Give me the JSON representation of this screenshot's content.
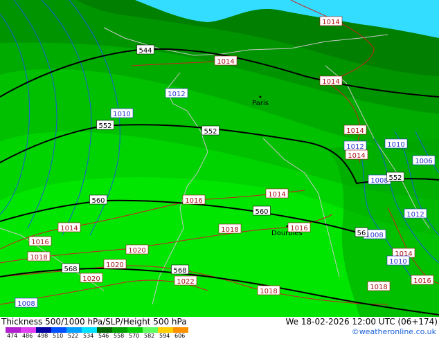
{
  "map": {
    "cities": [
      {
        "name": "Paris"
      },
      {
        "name": "Dourbies"
      }
    ],
    "slp_labels": [
      "1014",
      "1014",
      "1014",
      "1012",
      "1010",
      "1014",
      "1012",
      "1014",
      "1010",
      "1006",
      "1008",
      "1014",
      "1016",
      "1014",
      "1016",
      "1016",
      "1018",
      "1018",
      "1020",
      "1020",
      "1020",
      "1022",
      "1008",
      "1008",
      "1012",
      "1014",
      "1010",
      "1016",
      "1018",
      "1018"
    ],
    "height_labels": [
      "544",
      "552",
      "552",
      "560",
      "560",
      "568",
      "568",
      "552",
      "56"
    ],
    "colors": {
      "sea": "#33ddff",
      "thickness_bands": [
        "#007f00",
        "#009500",
        "#00ab00",
        "#00c000",
        "#00d400",
        "#00e600"
      ],
      "slp_isobar": "#cc2222",
      "height_contour": "#000000",
      "thickness_contour": "#1a5fd6",
      "coast": "#c8c8c8"
    }
  },
  "footer": {
    "title": "Thickness 500/1000 hPa/SLP/Height 500 hPa",
    "datetime": "We 18-02-2026 12:00 UTC (06+174)",
    "credit": "©weatheronline.co.uk",
    "legend_values": [
      "474",
      "486",
      "498",
      "510",
      "522",
      "534",
      "546",
      "558",
      "570",
      "582",
      "594",
      "606"
    ],
    "legend_colors": [
      "#b020d0",
      "#e040f0",
      "#0000a0",
      "#0050ff",
      "#00a0ff",
      "#00e0ff",
      "#006400",
      "#00a000",
      "#00d000",
      "#60ff60",
      "#ffd000",
      "#ff9000"
    ]
  }
}
